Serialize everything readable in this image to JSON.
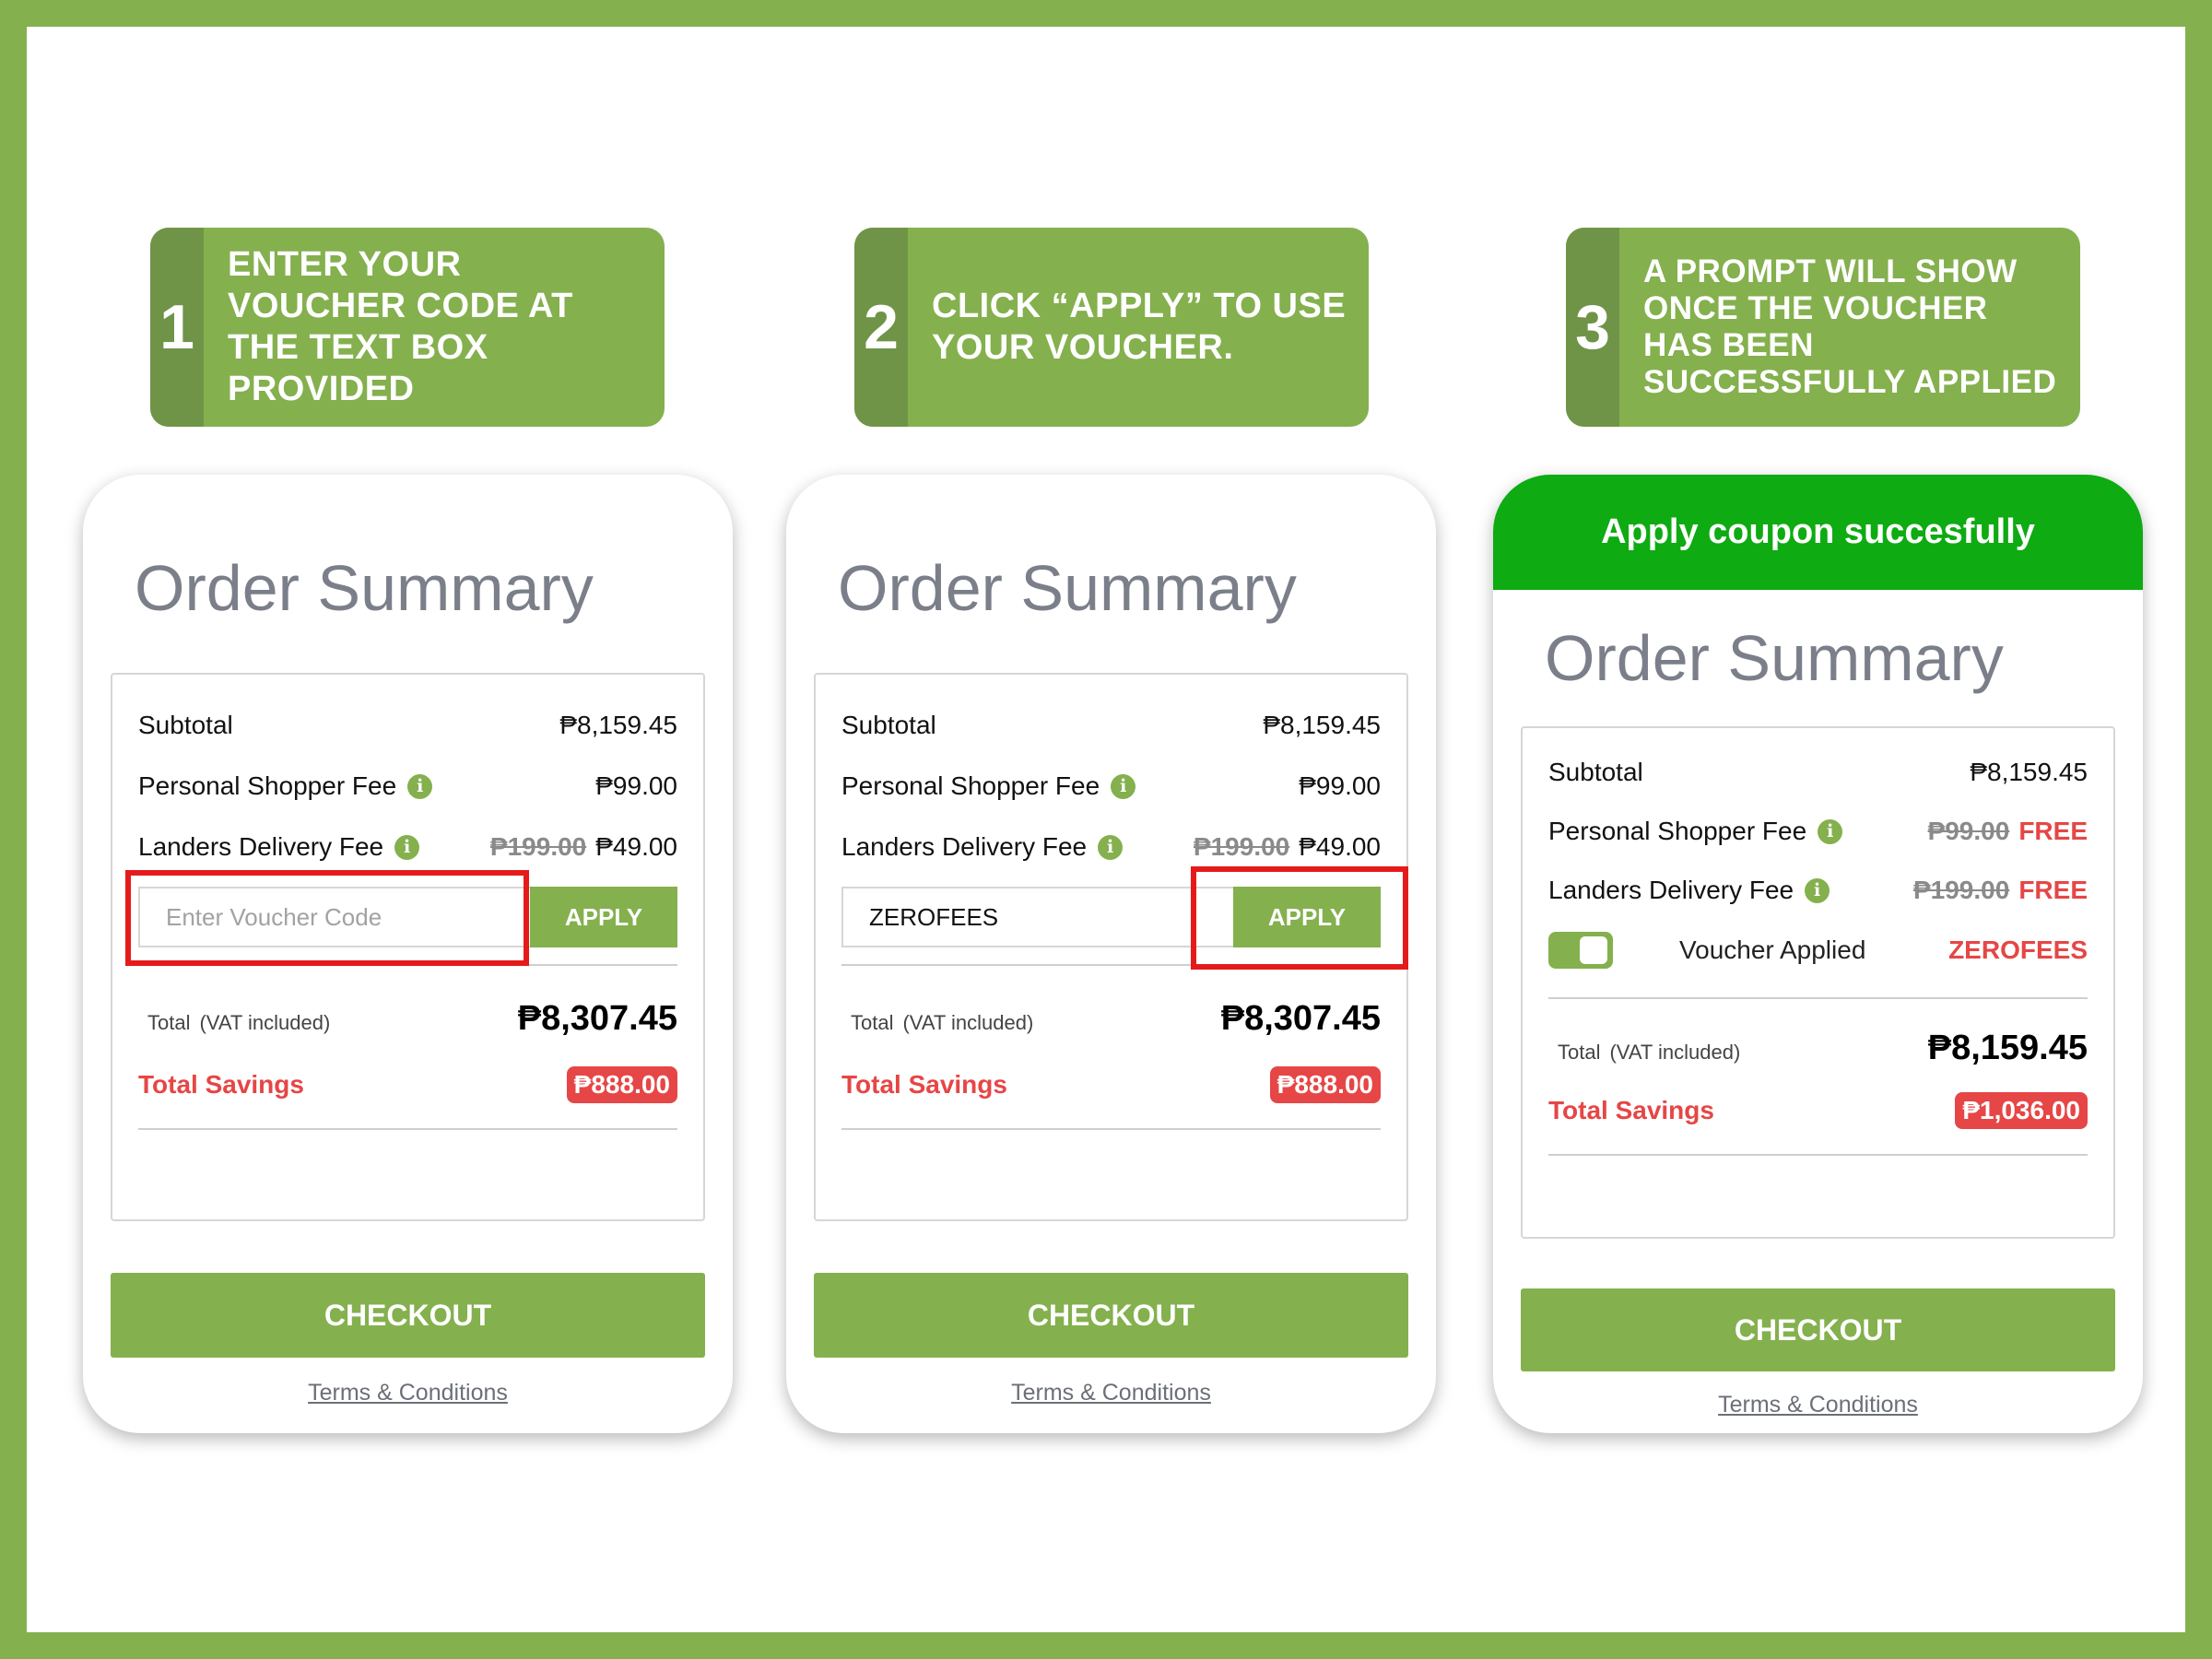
{
  "steps": [
    {
      "num": "1",
      "text": "ENTER YOUR VOUCHER CODE AT THE TEXT BOX PROVIDED"
    },
    {
      "num": "2",
      "text_pre": "CLICK “",
      "text_bold": "APPLY",
      "text_post": "” TO USE YOUR VOUCHER."
    },
    {
      "num": "3",
      "text": "A PROMPT WILL SHOW ONCE THE VOUCHER HAS BEEN SUCCESSFULLY APPLIED"
    }
  ],
  "cards": [
    {
      "title": "Order Summary",
      "subtotal_label": "Subtotal",
      "subtotal": "₱8,159.45",
      "shopper_label": "Personal Shopper Fee",
      "shopper_fee": "₱99.00",
      "delivery_label": "Landers Delivery Fee",
      "delivery_old": "₱199.00",
      "delivery_fee": "₱49.00",
      "voucher_placeholder": "Enter Voucher Code",
      "apply_label": "APPLY",
      "total_label": "Total",
      "vat_label": "(VAT included)",
      "total": "₱8,307.45",
      "savings_label": "Total Savings",
      "savings": "₱888.00",
      "checkout_label": "CHECKOUT",
      "terms_label": "Terms & Conditions"
    },
    {
      "title": "Order Summary",
      "subtotal_label": "Subtotal",
      "subtotal": "₱8,159.45",
      "shopper_label": "Personal Shopper Fee",
      "shopper_fee": "₱99.00",
      "delivery_label": "Landers Delivery Fee",
      "delivery_old": "₱199.00",
      "delivery_fee": "₱49.00",
      "voucher_value": "ZEROFEES",
      "apply_label": "APPLY",
      "total_label": "Total",
      "vat_label": "(VAT included)",
      "total": "₱8,307.45",
      "savings_label": "Total Savings",
      "savings": "₱888.00",
      "checkout_label": "CHECKOUT",
      "terms_label": "Terms & Conditions"
    },
    {
      "prompt": "Apply coupon succesfully",
      "title": "Order Summary",
      "subtotal_label": "Subtotal",
      "subtotal": "₱8,159.45",
      "shopper_label": "Personal Shopper Fee",
      "shopper_old": "₱99.00",
      "shopper_fee": "FREE",
      "delivery_label": "Landers Delivery Fee",
      "delivery_old": "₱199.00",
      "delivery_fee": "FREE",
      "voucher_applied_label": "Voucher Applied",
      "voucher_code": "ZEROFEES",
      "total_label": "Total",
      "vat_label": "(VAT included)",
      "total": "₱8,159.45",
      "savings_label": "Total Savings",
      "savings": "₱1,036.00",
      "checkout_label": "CHECKOUT",
      "terms_label": "Terms & Conditions"
    }
  ],
  "colors": {
    "brand_green": "#84b04e",
    "dark_green": "#6f9447",
    "prompt_green": "#0eab12",
    "savings_red": "#e64646",
    "highlight_red": "#e51b1b"
  }
}
